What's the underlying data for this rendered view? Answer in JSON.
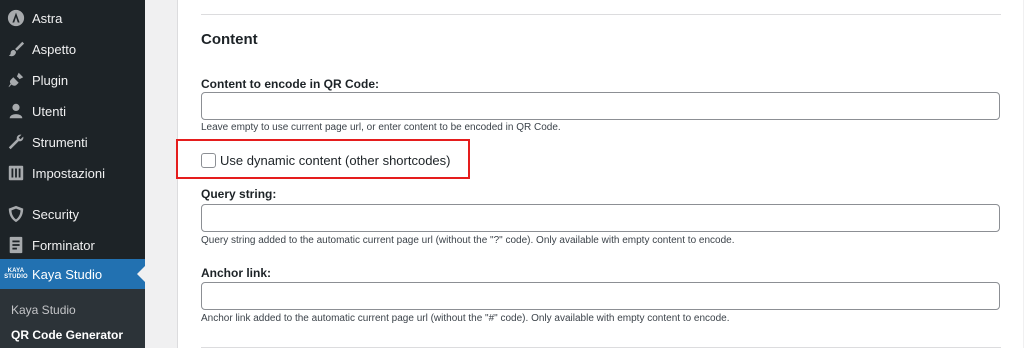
{
  "sidebar": {
    "items": [
      {
        "label": "Astra",
        "icon": "astra-icon"
      },
      {
        "label": "Aspetto",
        "icon": "paintbrush-icon"
      },
      {
        "label": "Plugin",
        "icon": "plugin-icon"
      },
      {
        "label": "Utenti",
        "icon": "users-icon"
      },
      {
        "label": "Strumenti",
        "icon": "wrench-icon"
      },
      {
        "label": "Impostazioni",
        "icon": "settings-icon"
      },
      {
        "label": "Security",
        "icon": "shield-icon"
      },
      {
        "label": "Forminator",
        "icon": "form-icon"
      },
      {
        "label": "Kaya Studio",
        "icon": "kaya-studio-icon",
        "logo_text_1": "KAYA",
        "logo_text_2": "STUDIO",
        "active": true
      }
    ],
    "submenu": [
      {
        "label": "Kaya Studio"
      },
      {
        "label": "QR Code Generator",
        "current": true
      }
    ],
    "active_color": "#2271b1",
    "background_color": "#1d2327"
  },
  "content": {
    "section_title": "Content",
    "content_field": {
      "label": "Content to encode in QR Code:",
      "value": "",
      "help": "Leave empty to use current page url, or enter content to be encoded in QR Code."
    },
    "dynamic_checkbox": {
      "label": "Use dynamic content (other shortcodes)",
      "checked": false,
      "highlight_color": "#e51d1d"
    },
    "query_field": {
      "label": "Query string:",
      "value": "",
      "help": "Query string added to the automatic current page url (without the \"?\" code). Only available with empty content to encode."
    },
    "anchor_field": {
      "label": "Anchor link:",
      "value": "",
      "help": "Anchor link added to the automatic current page url (without the \"#\" code). Only available with empty content to encode."
    }
  }
}
